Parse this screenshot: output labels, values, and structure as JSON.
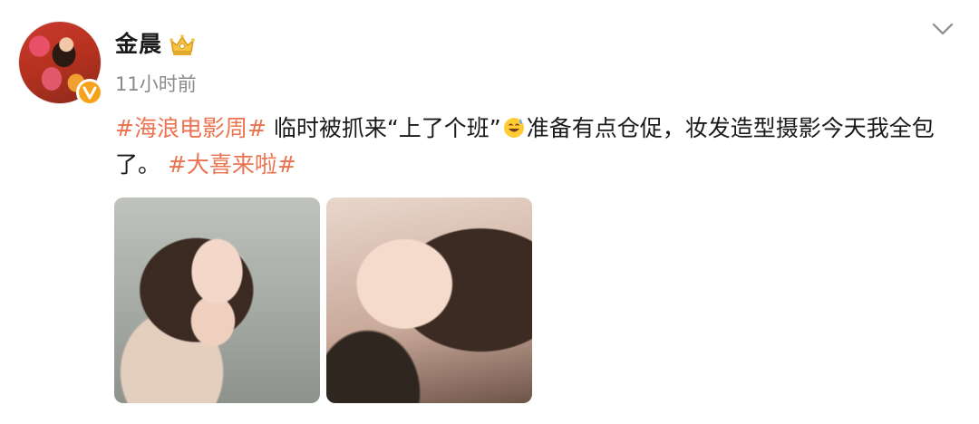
{
  "post": {
    "username": "金晨",
    "timestamp": "11小时前",
    "text": {
      "hashtag_1": "#海浪电影周#",
      "segment_1": " 临时被抓来“上了个班”",
      "emoji": "sweat-smile-emoji",
      "segment_2": "准备有点仓促，妆发造型摄影今天我全包了。",
      "hashtag_2": "#大喜来啦#"
    },
    "images": [
      {
        "icon": "selfie-photo-1"
      },
      {
        "icon": "selfie-photo-2"
      }
    ]
  },
  "colors": {
    "hashtag": "#eb7350",
    "verified_badge": "#f7a21b",
    "timestamp": "#8a8a8a"
  },
  "icons": {
    "verified": "verified-v-icon",
    "crown": "crown-icon",
    "menu": "chevron-down-icon"
  }
}
